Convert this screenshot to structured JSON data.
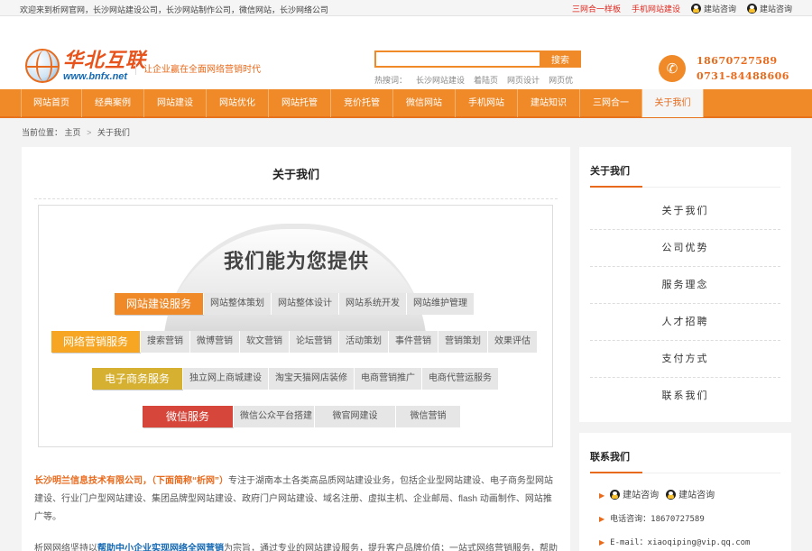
{
  "topbar": {
    "welcome": "欢迎来到析网官网，长沙网站建设公司，长沙网站制作公司，微信网站，长沙网络公司",
    "links": [
      "三网合一样板",
      "手机网站建设"
    ],
    "qq1": "建站咨询",
    "qq2": "建站咨询"
  },
  "header": {
    "logo_cn": "华北互联",
    "logo_en": "www.bnfx.net",
    "slogan": "让企业赢在全面网络营销时代",
    "search_button": "搜索",
    "search_placeholder": "",
    "hot_label": "热搜词：",
    "hot_words": [
      "长沙网站建设",
      "着陆页",
      "网页设计",
      "网页优"
    ],
    "phone1": "18670727589",
    "phone2": "0731-84488606"
  },
  "nav": {
    "items": [
      "网站首页",
      "经典案例",
      "网站建设",
      "网站优化",
      "网站托管",
      "竞价托管",
      "微信网站",
      "手机网站",
      "建站知识",
      "三网合一",
      "关于我们"
    ],
    "active": "关于我们"
  },
  "breadcrumb": {
    "label": "当前位置：",
    "home": "主页",
    "sep": ">",
    "current": "关于我们"
  },
  "main": {
    "title": "关于我们",
    "banner_heading": "我们能为您提供",
    "services": [
      {
        "label": "网站建设服务",
        "color": "#f08a28",
        "items": [
          "网站整体策划",
          "网站整体设计",
          "网站系统开发",
          "网站维护管理"
        ]
      },
      {
        "label": "网络营销服务",
        "color": "#f6a623",
        "items": [
          "搜索营销",
          "微博营销",
          "软文营销",
          "论坛营销",
          "活动策划",
          "事件营销",
          "营销策划",
          "效果评估"
        ]
      },
      {
        "label": "电子商务服务",
        "color": "#d5b031",
        "items": [
          "独立网上商城建设",
          "淘宝天猫网店装修",
          "电商营销推广",
          "电商代营运服务"
        ]
      },
      {
        "label": "微信服务",
        "color": "#d6463a",
        "items": [
          "微信公众平台搭建",
          "微官网建设",
          "微信营销"
        ]
      }
    ],
    "intro_org": "长沙明兰信息技术有限公司，（下面简称“析网”）",
    "intro_text": "专注于湖南本土各类高品质网站建设业务，包括企业型网站建设、电子商务型网站建设、行业门户型网站建设、集团品牌型网站建设、政府门户网站建设、域名注册、虚拟主机、企业邮局、flash 动画制作、网站推广等。",
    "intro2_start": "析网网络坚持以",
    "intro2_highlight": "帮助中小企业实现网络全网营销",
    "intro2_end": "为宗旨，通过专业的网站建设服务，提升客户品牌价值；一站式网络营销服务，帮助"
  },
  "sidebar": {
    "about_title": "关于我们",
    "about_items": [
      "关于我们",
      "公司优势",
      "服务理念",
      "人才招聘",
      "支付方式",
      "联系我们"
    ],
    "contact_title": "联系我们",
    "contact_qq1": "建站咨询",
    "contact_qq2": "建站咨询",
    "phone": "电话咨询：18670727589",
    "email": "E-mail：xiaoqiping@vip.qq.com"
  }
}
